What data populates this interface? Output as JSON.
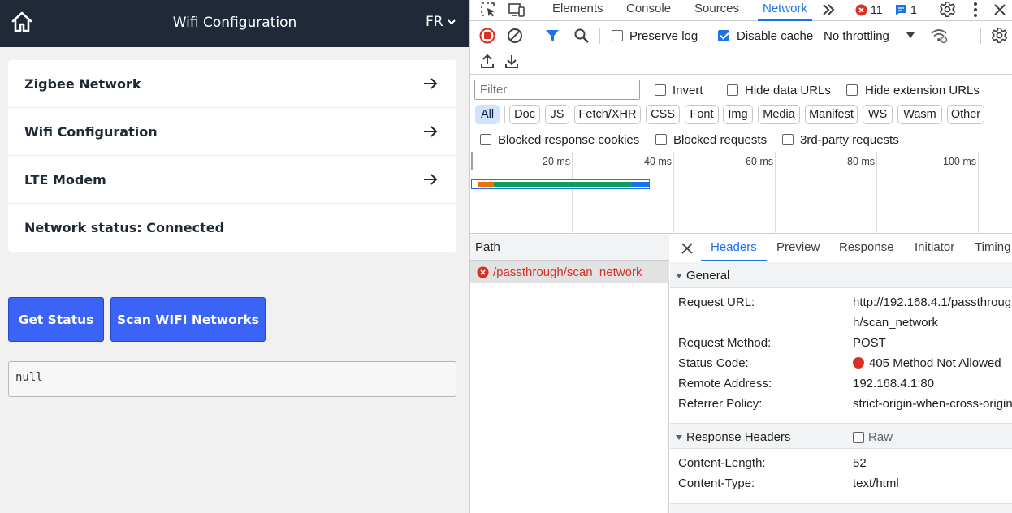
{
  "app": {
    "title": "Wifi Configuration",
    "language": "FR",
    "menu": [
      {
        "label": "Zigbee Network"
      },
      {
        "label": "Wifi Configuration"
      },
      {
        "label": "LTE Modem"
      }
    ],
    "network_status": "Network status: Connected",
    "buttons": {
      "get_status": "Get Status",
      "scan_wifi": "Scan WIFI Networks"
    },
    "output": "null"
  },
  "devtools": {
    "tabs": [
      "Elements",
      "Console",
      "Sources",
      "Network"
    ],
    "active_tab": "Network",
    "error_count": "11",
    "message_count": "1",
    "toolbar": {
      "preserve_log": "Preserve log",
      "disable_cache": "Disable cache",
      "throttling": "No throttling"
    },
    "filter": {
      "placeholder": "Filter",
      "invert": "Invert",
      "hide_data_urls": "Hide data URLs",
      "hide_extension_urls": "Hide extension URLs",
      "types": [
        "All",
        "Doc",
        "JS",
        "Fetch/XHR",
        "CSS",
        "Font",
        "Img",
        "Media",
        "Manifest",
        "WS",
        "Wasm",
        "Other"
      ],
      "blocked_cookies": "Blocked response cookies",
      "blocked_requests": "Blocked requests",
      "third_party": "3rd-party requests"
    },
    "timeline": {
      "ticks": [
        "20 ms",
        "40 ms",
        "60 ms",
        "80 ms",
        "100 ms"
      ]
    },
    "request_list": {
      "column": "Path",
      "requests": [
        {
          "path": "/passthrough/scan_network",
          "status": "error"
        }
      ]
    },
    "details": {
      "tabs": [
        "Headers",
        "Preview",
        "Response",
        "Initiator",
        "Timing"
      ],
      "active_tab": "Headers",
      "general": {
        "title": "General",
        "request_url_key": "Request URL:",
        "request_url_line1": "http://192.168.4.1/passthroug",
        "request_url_line2": "h/scan_network",
        "request_method_key": "Request Method:",
        "request_method": "POST",
        "status_code_key": "Status Code:",
        "status_code": "405 Method Not Allowed",
        "remote_address_key": "Remote Address:",
        "remote_address": "192.168.4.1:80",
        "referrer_policy_key": "Referrer Policy:",
        "referrer_policy": "strict-origin-when-cross-origin"
      },
      "response_headers": {
        "title": "Response Headers",
        "raw_label": "Raw",
        "content_length_key": "Content-Length:",
        "content_length": "52",
        "content_type_key": "Content-Type:",
        "content_type": "text/html"
      }
    }
  }
}
